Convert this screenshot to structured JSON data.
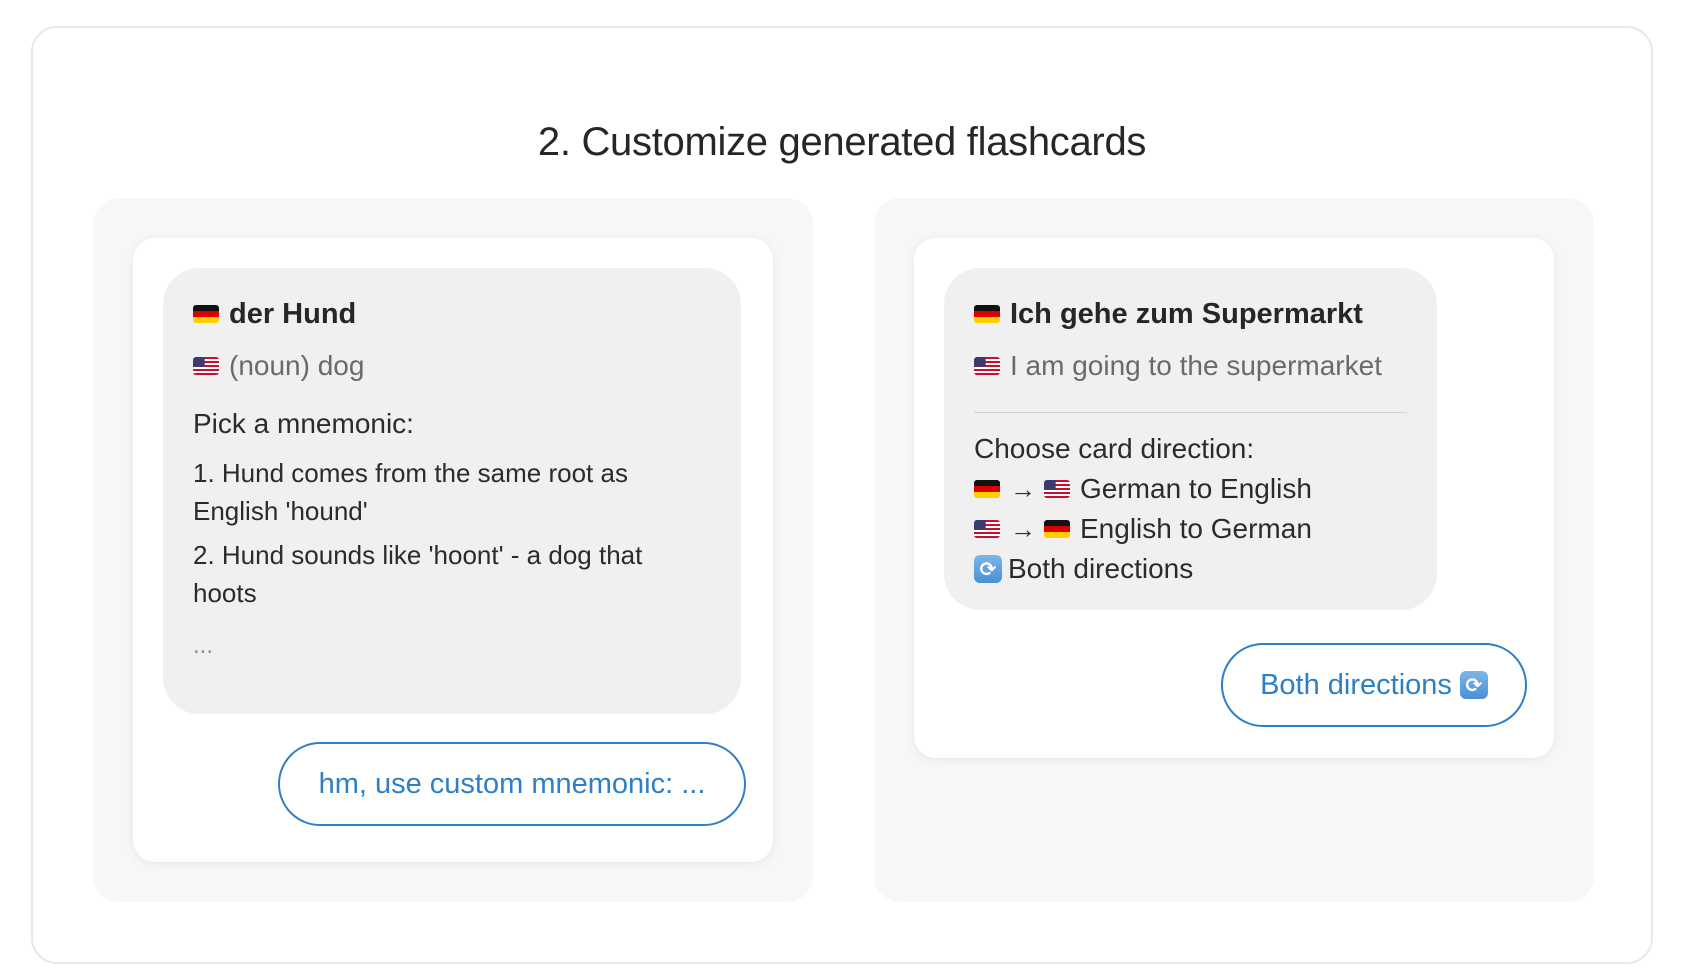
{
  "title": "2. Customize generated flashcards",
  "left_card": {
    "term": "der Hund",
    "term_flag": "flag-de",
    "translation": "(noun) dog",
    "translation_flag": "flag-us",
    "prompt": "Pick a mnemonic:",
    "mnemonics": [
      "1. Hund comes from the same root as English 'hound'",
      "2. Hund sounds like 'hoont' - a dog that hoots"
    ],
    "ellipsis": "...",
    "reply": "hm, use custom mnemonic: ..."
  },
  "right_card": {
    "term": "Ich gehe zum Supermarkt",
    "term_flag": "flag-de",
    "translation": "I am going to the supermarket",
    "translation_flag": "flag-us",
    "prompt": "Choose card direction:",
    "arrow": "→",
    "options": [
      {
        "from_flag": "flag-de",
        "to_flag": "flag-us",
        "label": "German to English"
      },
      {
        "from_flag": "flag-us",
        "to_flag": "flag-de",
        "label": "English to German"
      },
      {
        "icon": "swap-arrows-icon",
        "label": "Both directions"
      }
    ],
    "reply": "Both directions",
    "reply_icon": "swap-arrows-icon"
  },
  "colors": {
    "accent": "#2f7fc6",
    "bubble_bg": "#f0f0f0",
    "panel_bg": "#f6f7f9",
    "muted_text": "#6a6a6a"
  }
}
